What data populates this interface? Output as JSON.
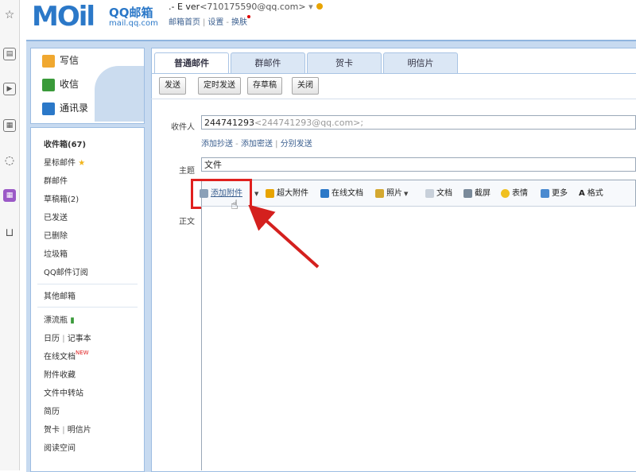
{
  "strip_icons": [
    "star-icon",
    "card-icon",
    "play-icon",
    "calendar-icon",
    "chat-icon",
    "apps-icon",
    "cart-icon"
  ],
  "header": {
    "logo": "MOil",
    "logo_cn": "QQ邮箱",
    "logo_domain": "mail.qq.com",
    "username": ".- E ver",
    "email": "<710175590@qq.com>",
    "arrow": "▾",
    "links": [
      "邮箱首页",
      "设置",
      "换肤"
    ]
  },
  "sidebar": {
    "actions": [
      {
        "label": "写信",
        "color": "#f0a830"
      },
      {
        "label": "收信",
        "color": "#3a9a3a"
      },
      {
        "label": "通讯录",
        "color": "#2b78c8"
      }
    ],
    "folders": [
      {
        "label": "收件箱(67)",
        "bold": true
      },
      {
        "label": "星标邮件",
        "star": true
      },
      {
        "label": "群邮件"
      },
      {
        "label": "草稿箱(2)"
      },
      {
        "label": "已发送"
      },
      {
        "label": "已删除"
      },
      {
        "label": "垃圾箱"
      },
      {
        "label": "QQ邮件订阅"
      }
    ],
    "other": "其他邮箱",
    "apps": [
      {
        "label": "漂流瓶"
      },
      {
        "label": "日历",
        "label2": "记事本"
      },
      {
        "label": "在线文档",
        "badge": "NEW"
      },
      {
        "label": "附件收藏"
      },
      {
        "label": "文件中转站"
      },
      {
        "label": "简历"
      },
      {
        "label": "贺卡",
        "label2": "明信片"
      },
      {
        "label": "阅读空间"
      }
    ]
  },
  "compose": {
    "tabs": [
      "普通邮件",
      "群邮件",
      "贺卡",
      "明信片"
    ],
    "buttons": [
      "发送",
      "定时发送",
      "存草稿",
      "关闭"
    ],
    "to_label": "收件人",
    "to_name": "244741293",
    "to_addr": "<244741293@qq.com>;",
    "cc_links": [
      "添加抄送",
      "添加密送",
      "分别发送"
    ],
    "subject_label": "主题",
    "subject_value": "文件",
    "body_label": "正文",
    "format_bar": {
      "add_attachment": "添加附件",
      "large_attachment": "超大附件",
      "online_doc": "在线文档",
      "photo": "照片",
      "document": "文档",
      "screenshot": "截屏",
      "emoji": "表情",
      "more": "更多",
      "format": "格式"
    }
  },
  "colors": {
    "accent": "#2b78c8",
    "frame": "#c7daf0",
    "highlight": "#e0201e"
  }
}
